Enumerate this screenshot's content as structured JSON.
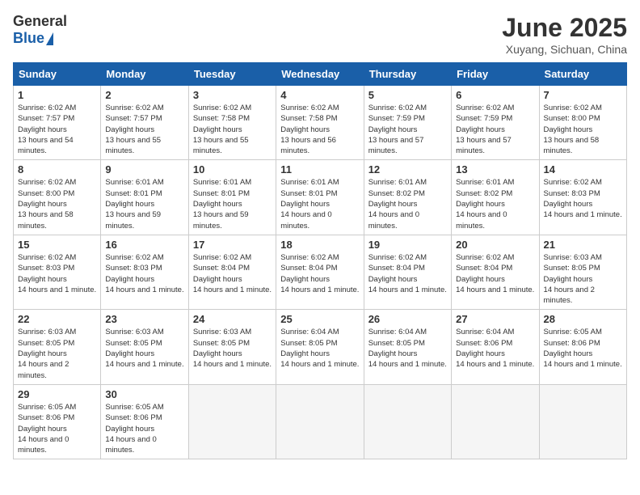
{
  "header": {
    "logo_general": "General",
    "logo_blue": "Blue",
    "month_title": "June 2025",
    "location": "Xuyang, Sichuan, China"
  },
  "calendar": {
    "days_of_week": [
      "Sunday",
      "Monday",
      "Tuesday",
      "Wednesday",
      "Thursday",
      "Friday",
      "Saturday"
    ],
    "weeks": [
      [
        null,
        {
          "day": 2,
          "sunrise": "6:02 AM",
          "sunset": "7:57 PM",
          "daylight": "13 hours and 55 minutes."
        },
        {
          "day": 3,
          "sunrise": "6:02 AM",
          "sunset": "7:58 PM",
          "daylight": "13 hours and 55 minutes."
        },
        {
          "day": 4,
          "sunrise": "6:02 AM",
          "sunset": "7:58 PM",
          "daylight": "13 hours and 56 minutes."
        },
        {
          "day": 5,
          "sunrise": "6:02 AM",
          "sunset": "7:59 PM",
          "daylight": "13 hours and 57 minutes."
        },
        {
          "day": 6,
          "sunrise": "6:02 AM",
          "sunset": "7:59 PM",
          "daylight": "13 hours and 57 minutes."
        },
        {
          "day": 7,
          "sunrise": "6:02 AM",
          "sunset": "8:00 PM",
          "daylight": "13 hours and 58 minutes."
        }
      ],
      [
        {
          "day": 1,
          "sunrise": "6:02 AM",
          "sunset": "7:57 PM",
          "daylight": "13 hours and 54 minutes."
        },
        {
          "day": 9,
          "sunrise": "6:01 AM",
          "sunset": "8:01 PM",
          "daylight": "13 hours and 59 minutes."
        },
        {
          "day": 10,
          "sunrise": "6:01 AM",
          "sunset": "8:01 PM",
          "daylight": "13 hours and 59 minutes."
        },
        {
          "day": 11,
          "sunrise": "6:01 AM",
          "sunset": "8:01 PM",
          "daylight": "14 hours and 0 minutes."
        },
        {
          "day": 12,
          "sunrise": "6:01 AM",
          "sunset": "8:02 PM",
          "daylight": "14 hours and 0 minutes."
        },
        {
          "day": 13,
          "sunrise": "6:01 AM",
          "sunset": "8:02 PM",
          "daylight": "14 hours and 0 minutes."
        },
        {
          "day": 14,
          "sunrise": "6:02 AM",
          "sunset": "8:03 PM",
          "daylight": "14 hours and 1 minute."
        }
      ],
      [
        {
          "day": 8,
          "sunrise": "6:02 AM",
          "sunset": "8:00 PM",
          "daylight": "13 hours and 58 minutes."
        },
        {
          "day": 16,
          "sunrise": "6:02 AM",
          "sunset": "8:03 PM",
          "daylight": "14 hours and 1 minute."
        },
        {
          "day": 17,
          "sunrise": "6:02 AM",
          "sunset": "8:04 PM",
          "daylight": "14 hours and 1 minute."
        },
        {
          "day": 18,
          "sunrise": "6:02 AM",
          "sunset": "8:04 PM",
          "daylight": "14 hours and 1 minute."
        },
        {
          "day": 19,
          "sunrise": "6:02 AM",
          "sunset": "8:04 PM",
          "daylight": "14 hours and 1 minute."
        },
        {
          "day": 20,
          "sunrise": "6:02 AM",
          "sunset": "8:04 PM",
          "daylight": "14 hours and 1 minute."
        },
        {
          "day": 21,
          "sunrise": "6:03 AM",
          "sunset": "8:05 PM",
          "daylight": "14 hours and 2 minutes."
        }
      ],
      [
        {
          "day": 15,
          "sunrise": "6:02 AM",
          "sunset": "8:03 PM",
          "daylight": "14 hours and 1 minute."
        },
        {
          "day": 23,
          "sunrise": "6:03 AM",
          "sunset": "8:05 PM",
          "daylight": "14 hours and 1 minute."
        },
        {
          "day": 24,
          "sunrise": "6:03 AM",
          "sunset": "8:05 PM",
          "daylight": "14 hours and 1 minute."
        },
        {
          "day": 25,
          "sunrise": "6:04 AM",
          "sunset": "8:05 PM",
          "daylight": "14 hours and 1 minute."
        },
        {
          "day": 26,
          "sunrise": "6:04 AM",
          "sunset": "8:05 PM",
          "daylight": "14 hours and 1 minute."
        },
        {
          "day": 27,
          "sunrise": "6:04 AM",
          "sunset": "8:06 PM",
          "daylight": "14 hours and 1 minute."
        },
        {
          "day": 28,
          "sunrise": "6:05 AM",
          "sunset": "8:06 PM",
          "daylight": "14 hours and 1 minute."
        }
      ],
      [
        {
          "day": 22,
          "sunrise": "6:03 AM",
          "sunset": "8:05 PM",
          "daylight": "14 hours and 2 minutes."
        },
        {
          "day": 30,
          "sunrise": "6:05 AM",
          "sunset": "8:06 PM",
          "daylight": "14 hours and 0 minutes."
        },
        null,
        null,
        null,
        null,
        null
      ],
      [
        {
          "day": 29,
          "sunrise": "6:05 AM",
          "sunset": "8:06 PM",
          "daylight": "14 hours and 0 minutes."
        },
        null,
        null,
        null,
        null,
        null,
        null
      ]
    ]
  }
}
